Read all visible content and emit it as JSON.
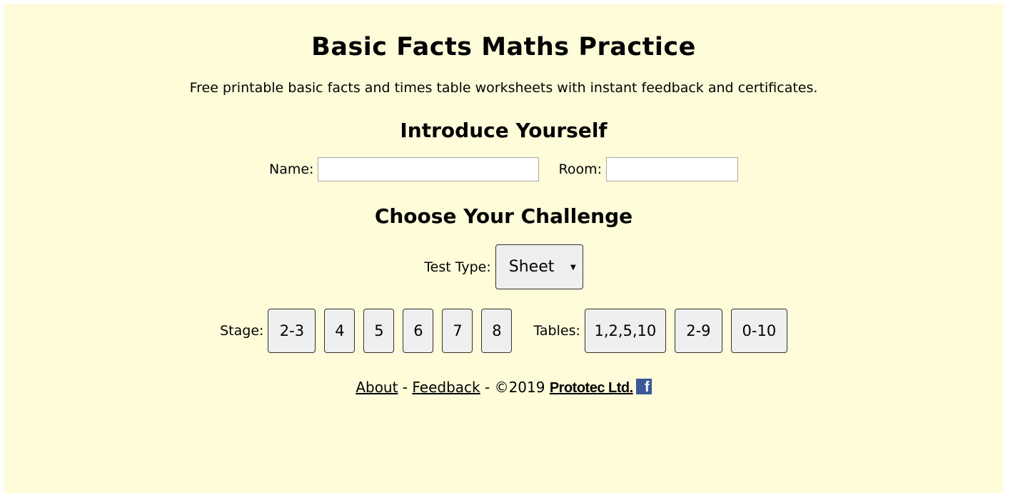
{
  "header": {
    "title": "Basic Facts Maths Practice",
    "subtitle": "Free printable basic facts and times table worksheets with instant feedback and certificates."
  },
  "intro": {
    "heading": "Introduce Yourself",
    "name_label": "Name:",
    "name_value": "",
    "room_label": "Room:",
    "room_value": ""
  },
  "challenge": {
    "heading": "Choose Your Challenge",
    "test_type_label": "Test Type:",
    "test_type_selected": "Sheet",
    "stage_label": "Stage:",
    "stages": [
      "2-3",
      "4",
      "5",
      "6",
      "7",
      "8"
    ],
    "tables_label": "Tables:",
    "tables": [
      "1,2,5,10",
      "2-9",
      "0-10"
    ]
  },
  "footer": {
    "about": "About",
    "sep1": " - ",
    "feedback": "Feedback",
    "sep2": " - ",
    "copyright": "©2019 ",
    "brand": "Prototec Ltd.",
    "facebook_icon": "facebook-icon",
    "facebook_glyph": "f"
  },
  "colors": {
    "background": "#fffdd9",
    "button_bg": "#efefef",
    "facebook_blue": "#3b5998"
  }
}
